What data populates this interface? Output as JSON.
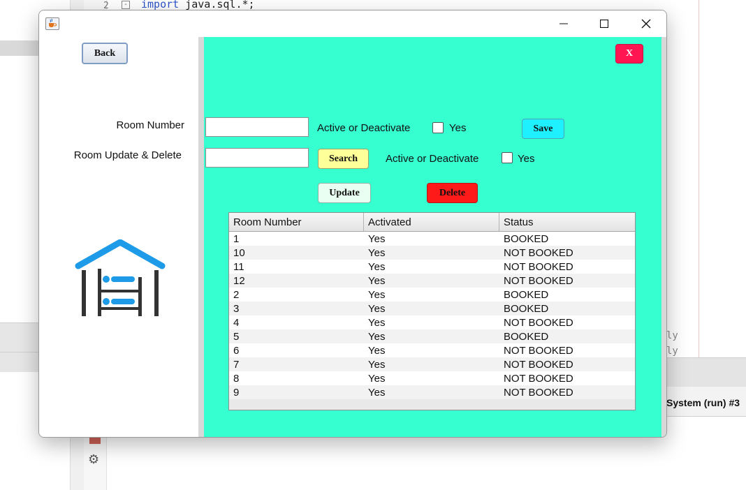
{
  "ide": {
    "line_number": "2",
    "fold_marker": "-",
    "code_keyword": "import",
    "code_rest": " java.sql.*;",
    "right_fragment": "ly",
    "status_text": "System (run) #3"
  },
  "window": {
    "title_icon": "java-cup-icon",
    "controls": {
      "minimize": "minimize-icon",
      "maximize": "maximize-icon",
      "close": "close-icon"
    }
  },
  "buttons": {
    "back": "Back",
    "close_x": "X",
    "save": "Save",
    "search": "Search",
    "update": "Update",
    "delete": "Delete"
  },
  "form": {
    "room_number_label": "Room Number",
    "room_update_label": "Room Update & Delete",
    "active_label_1": "Active or Deactivate",
    "active_label_2": "Active or Deactivate",
    "yes_1": "Yes",
    "yes_2": "Yes",
    "room_number_value": "",
    "search_value": ""
  },
  "logo": {
    "icon": "bunk-bed-house-icon"
  },
  "colors": {
    "panel_bg": "#36ffd0",
    "close_x_bg": "#ff1552",
    "save_bg": "#1ff0ff",
    "search_bg": "#ffff99",
    "update_bg": "#e9fff2",
    "delete_bg": "#ff1a1a",
    "logo_blue": "#1e9be8"
  },
  "table": {
    "columns": [
      "Room Number",
      "Activated",
      "Status"
    ],
    "rows": [
      [
        "1",
        "Yes",
        "BOOKED"
      ],
      [
        "10",
        "Yes",
        "NOT BOOKED"
      ],
      [
        "11",
        "Yes",
        "NOT BOOKED"
      ],
      [
        "12",
        "Yes",
        "NOT BOOKED"
      ],
      [
        "2",
        "Yes",
        "BOOKED"
      ],
      [
        "3",
        "Yes",
        "BOOKED"
      ],
      [
        "4",
        "Yes",
        "NOT BOOKED"
      ],
      [
        "5",
        "Yes",
        "BOOKED"
      ],
      [
        "6",
        "Yes",
        "NOT BOOKED"
      ],
      [
        "7",
        "Yes",
        "NOT BOOKED"
      ],
      [
        "8",
        "Yes",
        "NOT BOOKED"
      ],
      [
        "9",
        "Yes",
        "NOT BOOKED"
      ]
    ]
  }
}
